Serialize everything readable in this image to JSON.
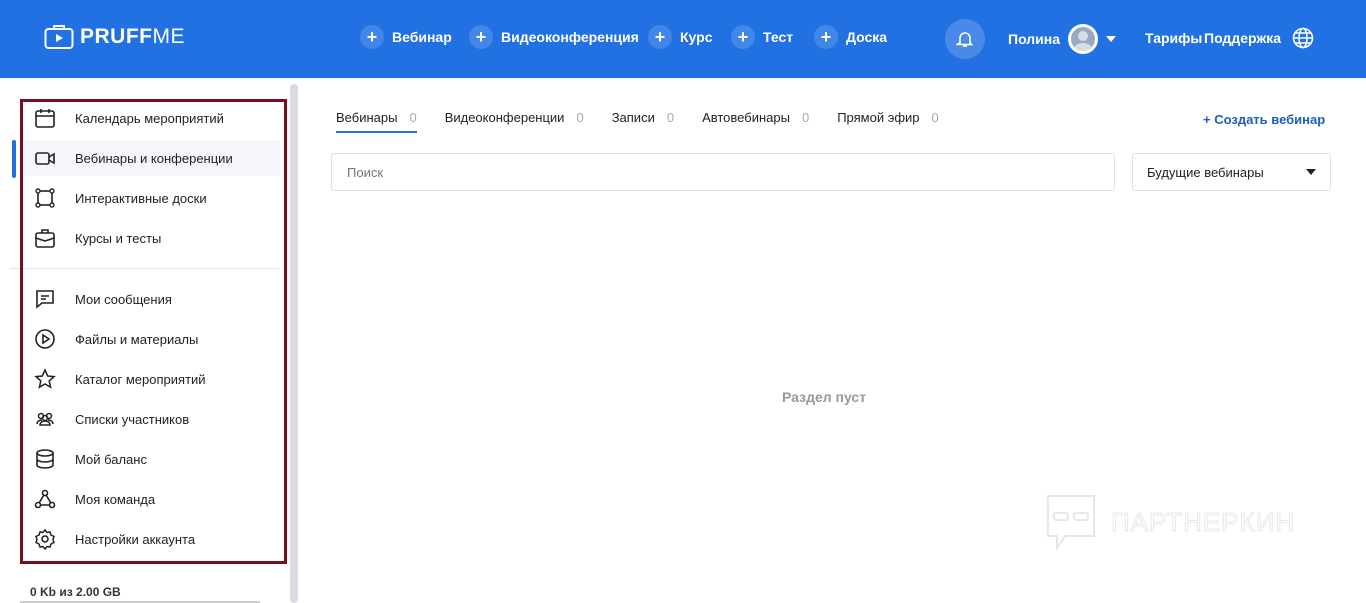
{
  "header": {
    "logo_bold": "PRUFF",
    "logo_light": "ME",
    "create_buttons": [
      {
        "label": "Вебинар"
      },
      {
        "label": "Видеоконференция"
      },
      {
        "label": "Курс"
      },
      {
        "label": "Тест"
      },
      {
        "label": "Доска"
      }
    ],
    "user_name": "Полина",
    "tariffs": "Тарифы",
    "support": "Поддержка"
  },
  "sidebar": {
    "items": [
      {
        "label": "Календарь мероприятий",
        "icon": "calendar-icon"
      },
      {
        "label": "Вебинары и конференции",
        "icon": "video-icon",
        "active": true
      },
      {
        "label": "Интерактивные доски",
        "icon": "board-icon"
      },
      {
        "label": "Курсы и тесты",
        "icon": "briefcase-icon"
      },
      {
        "label": "Мои сообщения",
        "icon": "message-icon"
      },
      {
        "label": "Файлы и материалы",
        "icon": "play-circle-icon"
      },
      {
        "label": "Каталог мероприятий",
        "icon": "star-icon"
      },
      {
        "label": "Списки участников",
        "icon": "users-icon"
      },
      {
        "label": "Мой баланс",
        "icon": "database-icon"
      },
      {
        "label": "Моя команда",
        "icon": "team-icon"
      },
      {
        "label": "Настройки аккаунта",
        "icon": "gear-icon"
      }
    ],
    "storage": "0 Kb из 2.00 GB"
  },
  "main": {
    "tabs": [
      {
        "label": "Вебинары",
        "count": "0"
      },
      {
        "label": "Видеоконференции",
        "count": "0"
      },
      {
        "label": "Записи",
        "count": "0"
      },
      {
        "label": "Автовебинары",
        "count": "0"
      },
      {
        "label": "Прямой эфир",
        "count": "0"
      }
    ],
    "create_label": "+ Создать вебинар",
    "search_placeholder": "Поиск",
    "filter_value": "Будущие вебинары",
    "empty_text": "Раздел пуст"
  },
  "watermark": "ПАРТНЕРКИН",
  "colors": {
    "accent": "#2271e3",
    "highlight_frame": "#7a0d1c"
  }
}
